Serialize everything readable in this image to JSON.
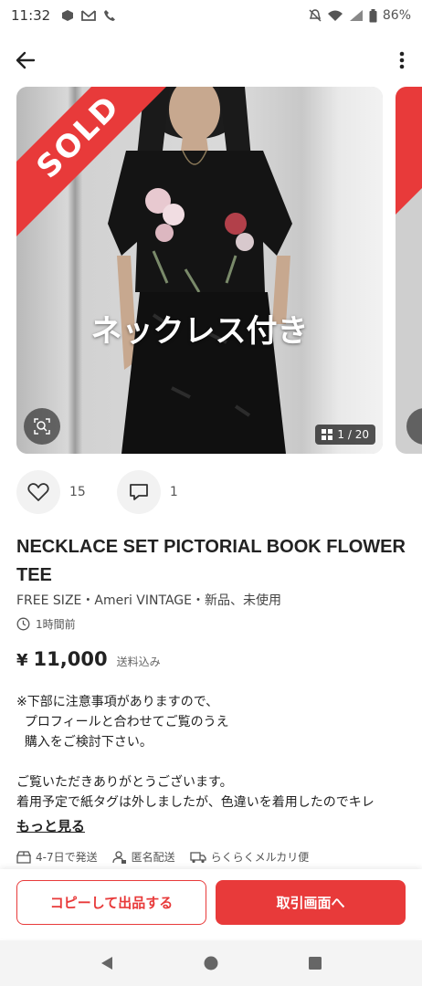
{
  "status_bar": {
    "time": "11:32",
    "battery": "86%"
  },
  "listing": {
    "photo_overlay_text": "ネックレス付き",
    "sold_label": "SOLD",
    "photo_counter": "1 / 20",
    "likes": "15",
    "comments": "1",
    "title": "NECKLACE SET PICTORIAL BOOK FLOWER TEE",
    "meta": "FREE SIZE・Ameri VINTAGE・新品、未使用",
    "posted": "1時間前",
    "price_symbol": "¥",
    "price": "11,000",
    "shipping_note": "送料込み",
    "description": "※下部に注意事項がありますので、\n  プロフィールと合わせてご覧のうえ\n  購入をご検討下さい。\n\nご覧いただきありがとうございます。\n着用予定で紙タグは外しましたが、色違いを着用したのでキレ",
    "more_link": "もっと見る"
  },
  "features": [
    {
      "label": "4-7日で発送",
      "icon": "box-icon"
    },
    {
      "label": "匿名配送",
      "icon": "anonymous-user-icon"
    },
    {
      "label": "らくらくメルカリ便",
      "icon": "truck-icon"
    }
  ],
  "buttons": {
    "copy_label": "コピーして出品する",
    "trade_label": "取引画面へ"
  },
  "colors": {
    "accent": "#e83a3a",
    "text": "#222222"
  }
}
